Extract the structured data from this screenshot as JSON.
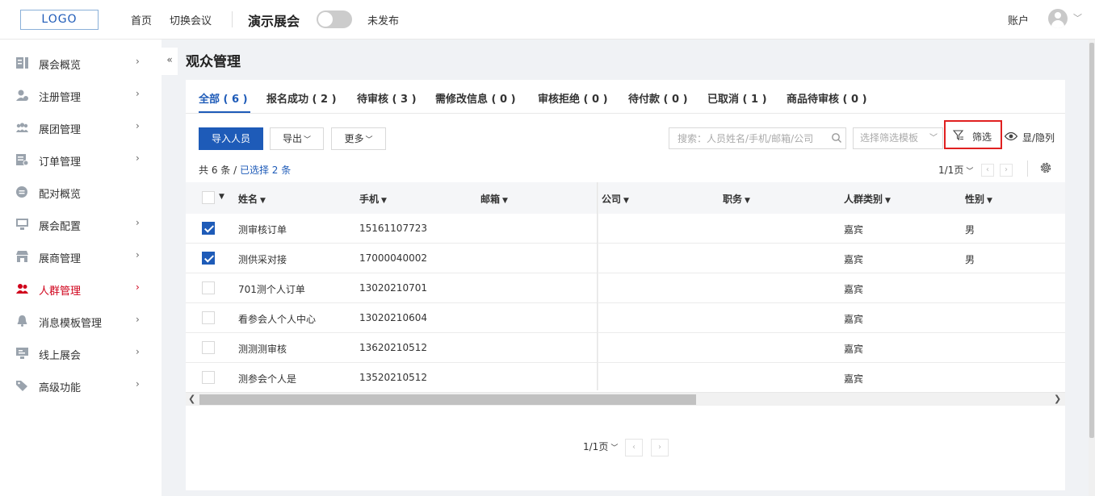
{
  "header": {
    "logo_text": "LOGO",
    "nav": [
      "首页",
      "切换会议"
    ],
    "expo_name": "演示展会",
    "publish_status": "未发布",
    "account_label": "账户"
  },
  "sidebar": {
    "collapse_glyph": "«",
    "items": [
      {
        "label": "展会概览",
        "icon": "overview-icon",
        "has_arrow": true
      },
      {
        "label": "注册管理",
        "icon": "registration-icon",
        "has_arrow": true
      },
      {
        "label": "展团管理",
        "icon": "group-icon",
        "has_arrow": true
      },
      {
        "label": "订单管理",
        "icon": "order-icon",
        "has_arrow": true
      },
      {
        "label": "配对概览",
        "icon": "match-icon",
        "has_arrow": false
      },
      {
        "label": "展会配置",
        "icon": "config-icon",
        "has_arrow": true
      },
      {
        "label": "展商管理",
        "icon": "exhibitor-icon",
        "has_arrow": true
      },
      {
        "label": "人群管理",
        "icon": "people-icon",
        "has_arrow": true,
        "active": true
      },
      {
        "label": "消息模板管理",
        "icon": "bell-icon",
        "has_arrow": true
      },
      {
        "label": "线上展会",
        "icon": "online-icon",
        "has_arrow": true
      },
      {
        "label": "高级功能",
        "icon": "tag-icon",
        "has_arrow": true
      }
    ]
  },
  "page": {
    "title": "观众管理",
    "tabs": [
      "全部 ( 6 )",
      "报名成功 ( 2 )",
      "待审核 ( 3 )",
      "需修改信息 ( 0 )",
      "审核拒绝 ( 0 )",
      "待付款 ( 0 )",
      "已取消 ( 1 )",
      "商品待审核 ( 0 )"
    ],
    "active_tab": 0,
    "toolbar": {
      "import_label": "导入人员",
      "export_label": "导出",
      "more_label": "更多",
      "search_placeholder": "搜索：人员姓名/手机/邮箱/公司",
      "template_placeholder": "选择筛选模板",
      "filter_label": "筛选",
      "columns_label": "显/隐列"
    },
    "summary": {
      "total_text": "共 6 条 / ",
      "selected_text": "已选择 2 条"
    },
    "pager_text": "1/1页",
    "table": {
      "columns": [
        "姓名",
        "手机",
        "邮箱",
        "公司",
        "职务",
        "人群类别",
        "性别"
      ],
      "rows": [
        {
          "checked": true,
          "name": "测审核订单",
          "phone": "15161107723",
          "email": "",
          "company": "",
          "title": "",
          "category": "嘉宾",
          "gender": "男"
        },
        {
          "checked": true,
          "name": "测供采对接",
          "phone": "17000040002",
          "email": "",
          "company": "",
          "title": "",
          "category": "嘉宾",
          "gender": "男"
        },
        {
          "checked": false,
          "name": "701测个人订单",
          "phone": "13020210701",
          "email": "",
          "company": "",
          "title": "",
          "category": "嘉宾",
          "gender": ""
        },
        {
          "checked": false,
          "name": "看参会人个人中心",
          "phone": "13020210604",
          "email": "",
          "company": "",
          "title": "",
          "category": "嘉宾",
          "gender": ""
        },
        {
          "checked": false,
          "name": "测测测审核",
          "phone": "13620210512",
          "email": "",
          "company": "",
          "title": "",
          "category": "嘉宾",
          "gender": ""
        },
        {
          "checked": false,
          "name": "测参会个人是",
          "phone": "13520210512",
          "email": "",
          "company": "",
          "title": "",
          "category": "嘉宾",
          "gender": ""
        }
      ]
    }
  },
  "colors": {
    "accent": "#1e5bb8",
    "active_menu": "#d0021b",
    "highlight_box": "#e02020"
  }
}
